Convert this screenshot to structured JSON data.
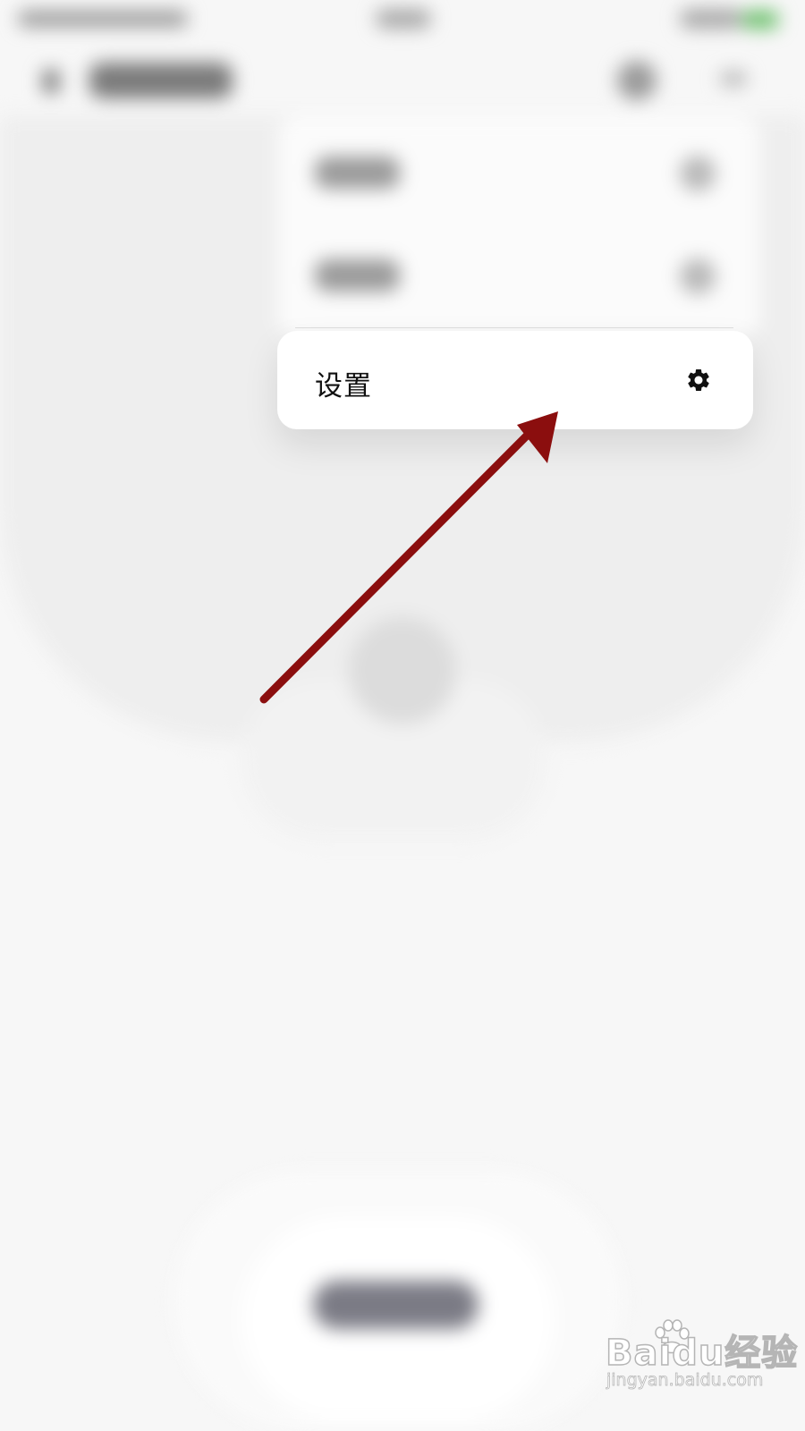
{
  "menu": {
    "settings_label": "设置",
    "settings_icon": "gear-icon"
  },
  "annotation": {
    "arrow_color": "#8b0e0e",
    "arrow_target": "settings-menu-item"
  },
  "watermark": {
    "logo_text": "Baidu经验",
    "url": "jingyan.baidu.com"
  }
}
